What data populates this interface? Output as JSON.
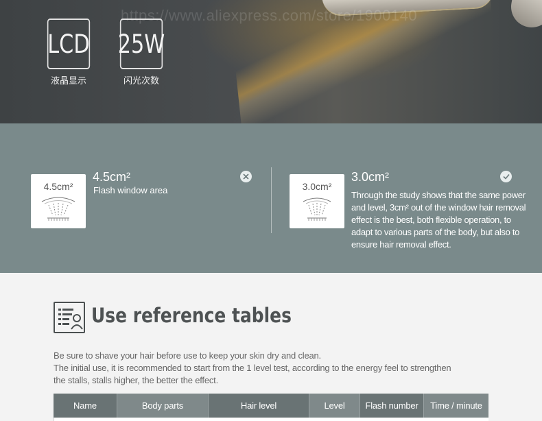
{
  "hero": {
    "watermark": "https://www.aliexpress.com/store/1900140",
    "specs": [
      {
        "value": "LCD",
        "label": "液晶显示"
      },
      {
        "value": "25W",
        "label": "闪光次数"
      }
    ]
  },
  "comparison": {
    "left": {
      "card_text": "4.5cm²",
      "title": "4.5cm²",
      "subtitle": "Flash window area",
      "mark_icon": "cross-icon"
    },
    "right": {
      "card_text": "3.0cm²",
      "title": "3.0cm²",
      "description": "Through the study shows that the same power and level, 3cm² out of the window hair removal effect is the best, both flexible operation, to adapt to various parts of the body, but also to ensure hair removal effect.",
      "mark_icon": "check-icon"
    }
  },
  "reference": {
    "title": "Use reference tables",
    "lines": [
      "Be sure to shave your hair before use to keep your skin dry and clean.",
      "The initial use, it is recommended to start from the 1 level test, according to the energy feel to strengthen",
      "the stalls, stalls higher, the better the effect."
    ],
    "table_headers": [
      "Name",
      "Body parts",
      "Hair level",
      "Level",
      "Flash number",
      "Time / minute"
    ]
  },
  "colors": {
    "band": "#7a8a8b",
    "header_dark": "#697374",
    "header_light": "#7f898a",
    "title": "#4e5253"
  }
}
